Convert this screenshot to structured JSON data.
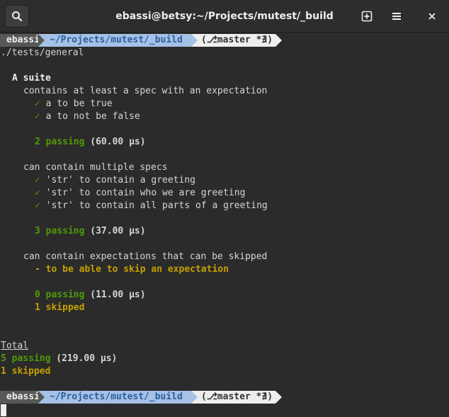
{
  "window": {
    "title": "ebassi@betsy:~/Projects/mutest/_build",
    "search_icon": "search-icon",
    "new_tab_icon": "new-tab-icon",
    "menu_icon": "hamburger-menu-icon",
    "close_icon": "close-icon"
  },
  "prompt": {
    "user": "ebassi",
    "path": "~/Projects/mutest/_build",
    "git": "(⎇master *∄)"
  },
  "output": {
    "command_path": "./tests/general",
    "suite_title": "A suite",
    "group1": {
      "title": "contains at least a spec with an expectation",
      "specs": [
        "a to be true",
        "a to not be false"
      ],
      "passing_count": "2 passing",
      "passing_time": "(60.00 µs)"
    },
    "group2": {
      "title": "can contain multiple specs",
      "specs": [
        "'str' to contain a greeting",
        "'str' to contain who we are greeting",
        "'str' to contain all parts of a greeting"
      ],
      "passing_count": "3 passing",
      "passing_time": "(37.00 µs)"
    },
    "group3": {
      "title": "can contain expectations that can be skipped",
      "skipped_spec": "to be able to skip an expectation",
      "passing_count": "0 passing",
      "passing_time": "(11.00 µs)",
      "skipped_count": "1 skipped"
    },
    "total": {
      "label": "Total",
      "passing_count": "5 passing",
      "passing_time": "(219.00 µs)",
      "skipped_count": "1 skipped"
    },
    "check_mark": "✓",
    "skip_mark": "-"
  },
  "colors": {
    "background": "#2b2b2b",
    "pass": "#4e9a06",
    "skip": "#c4a000",
    "prompt_user_bg": "#585858",
    "prompt_path_bg": "#a6c1e6",
    "prompt_git_bg": "#eeeeec"
  }
}
